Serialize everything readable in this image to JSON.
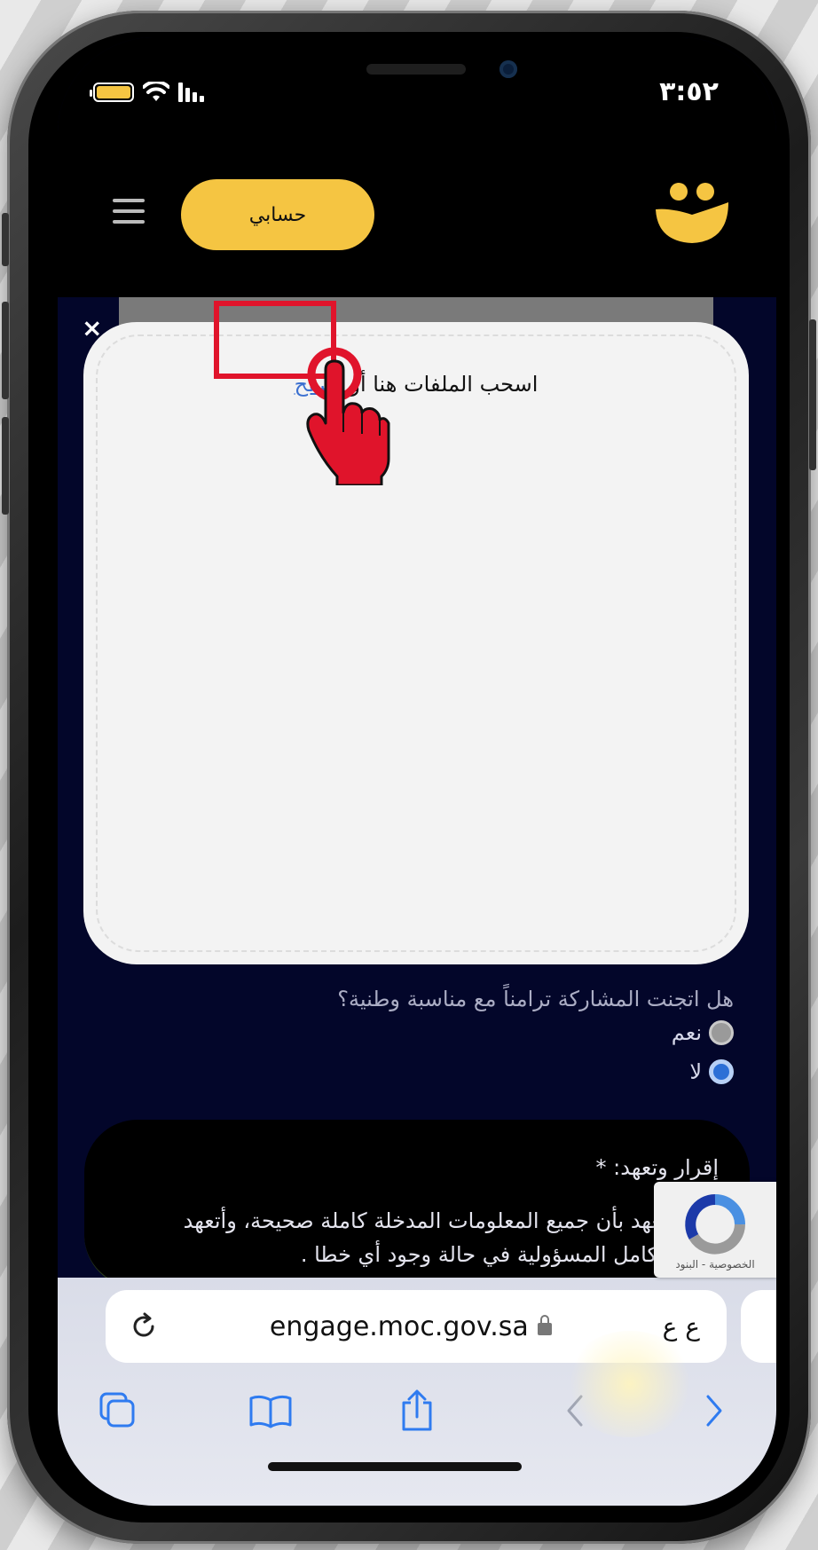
{
  "status_bar": {
    "time": "٣:٥٢"
  },
  "header": {
    "account_button": "حسابي",
    "close_label": "×"
  },
  "upload_modal": {
    "drop_text": "اسحب الملفات هنا أو",
    "browse_link": "تصفح"
  },
  "form": {
    "question": "هل اتجنت المشاركة ترامناً مع مناسبة وطنية؟",
    "options": [
      {
        "label": "نعم",
        "checked": false
      },
      {
        "label": "لا",
        "checked": true
      }
    ],
    "pledge_title": "إقرار وتعهد: *",
    "pledge_text": "أقر وأتعهد بأن جميع المعلومات المدخلة كاملة صحيحة، وأتعهد بتحمل كامل المسؤولية في حالة وجود أي خطا ."
  },
  "recaptcha": {
    "footer": "الخصوصية - البنود"
  },
  "browser": {
    "reload_icon": "reload-icon",
    "url": "engage.moc.gov.sa",
    "text_size": "ع ع"
  },
  "colors": {
    "accent": "#f5c542",
    "page_bg": "#03062a",
    "highlight": "#e0142b",
    "link": "#3a6fd0",
    "radio_selected": "#2c6fd6"
  }
}
